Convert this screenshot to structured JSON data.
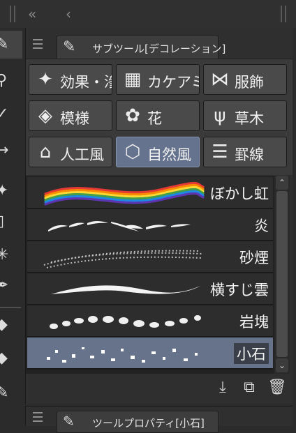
{
  "topbar": {
    "collapse_label": "«",
    "back_label": "‹"
  },
  "left_tools": [
    {
      "icon": "pen-icon",
      "glyph": "✎"
    },
    {
      "icon": "zoom-icon",
      "glyph": "⚲"
    },
    {
      "icon": "select-icon",
      "glyph": "✓"
    },
    {
      "icon": "move-icon",
      "glyph": "→"
    },
    {
      "icon": "star-icon",
      "glyph": "✦"
    },
    {
      "icon": "frame-icon",
      "glyph": "▯"
    },
    {
      "icon": "sparkle-icon",
      "glyph": "✳"
    },
    {
      "icon": "dropper-icon",
      "glyph": "✒"
    },
    {
      "icon": "eraser-icon",
      "glyph": "◆"
    },
    {
      "icon": "fill-icon",
      "glyph": "◆"
    },
    {
      "icon": "brush-icon",
      "glyph": "✎"
    }
  ],
  "subtool_panel": {
    "tab_title": "サブツール[デコレーション]",
    "tab_icon": "pen-icon"
  },
  "categories": [
    {
      "label": "効果・滲",
      "icon": "sparkle-icon",
      "glyph": "✦",
      "selected": false
    },
    {
      "label": "カケアミ",
      "icon": "crosshatch-icon",
      "glyph": "▦",
      "selected": false
    },
    {
      "label": "服飾",
      "icon": "ribbon-icon",
      "glyph": "⋈",
      "selected": false
    },
    {
      "label": "模様",
      "icon": "pattern-icon",
      "glyph": "◈",
      "selected": false
    },
    {
      "label": "花",
      "icon": "flower-icon",
      "glyph": "✿",
      "selected": false
    },
    {
      "label": "草木",
      "icon": "grass-icon",
      "glyph": "ψ",
      "selected": false
    },
    {
      "label": "人工風",
      "icon": "house-icon",
      "glyph": "⌂",
      "selected": false
    },
    {
      "label": "自然風",
      "icon": "rock-icon",
      "glyph": "⬡",
      "selected": true
    },
    {
      "label": "罫線",
      "icon": "lines-icon",
      "glyph": "☰",
      "selected": false
    }
  ],
  "brushes": [
    {
      "name": "ぼかし虹",
      "selected": false
    },
    {
      "name": "炎",
      "selected": false
    },
    {
      "name": "砂煙",
      "selected": false
    },
    {
      "name": "横すじ雲",
      "selected": false
    },
    {
      "name": "岩塊",
      "selected": false
    },
    {
      "name": "小石",
      "selected": true
    }
  ],
  "scroll": {
    "up_label": "⌃",
    "down_label": "⌄"
  },
  "bottom_actions": [
    {
      "icon": "import-icon",
      "glyph": "⤓"
    },
    {
      "icon": "duplicate-icon",
      "glyph": "⧉"
    },
    {
      "icon": "trash-icon",
      "glyph": "🗑"
    }
  ],
  "property_panel": {
    "tab_title": "ツールプロパティ[小石]",
    "tab_icon": "pen-icon"
  },
  "colors": {
    "selected_accent": "#66738a",
    "panel_bg": "#2f2f2f"
  }
}
